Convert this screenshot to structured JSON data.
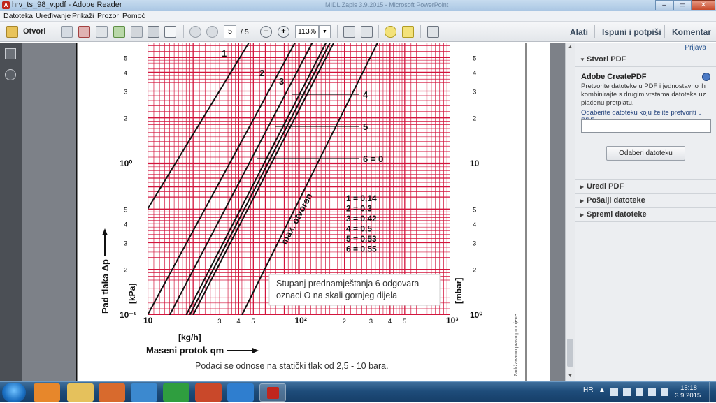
{
  "window": {
    "title": "hrv_ts_98_v.pdf - Adobe Reader",
    "background_title": "MIDL Zapis 3.9.2015 - Microsoft PowerPoint",
    "minimize": "–",
    "maximize": "▭",
    "close": "✕"
  },
  "menu": [
    "Datoteka",
    "Uređivanje",
    "Prikaži",
    "Prozor",
    "Pomoć"
  ],
  "toolbar": {
    "open_label": "Otvori",
    "page_current": "5",
    "page_total": "/ 5",
    "zoom": "113%",
    "tools": "Alati",
    "fill_sign": "Ispuni i potpiši",
    "comment": "Komentar"
  },
  "right_pane": {
    "signin": "Prijava",
    "create_pdf": "Stvori PDF",
    "service_title": "Adobe CreatePDF",
    "service_desc": "Pretvorite datoteke u PDF i jednostavno ih kombinirajte s drugim vrstama datoteka uz plaćenu pretplatu.",
    "select_prompt": "Odaberite datoteku koju želite pretvoriti u PDF:",
    "select_button": "Odaberi datoteku",
    "sections": [
      "Uredi PDF",
      "Pošalji datoteke",
      "Spremi datoteke"
    ]
  },
  "chart_data": {
    "type": "line",
    "scale": "log-log",
    "xlabel": "Maseni protok qm",
    "x_unit": "[kg/h]",
    "ylabel": "Pad tlaka Δp",
    "y_unit_left": "[kPa]",
    "y_unit_right": "[mbar]",
    "x_ticks": [
      "10",
      "3",
      "4",
      "5",
      "10²",
      "2",
      "3",
      "4",
      "5",
      "10³"
    ],
    "y_ticks_left": [
      "10⁻¹",
      "2",
      "3",
      "4",
      "5",
      "10⁰",
      "2",
      "3",
      "4",
      "5"
    ],
    "y_ticks_right": [
      "10⁰",
      "2",
      "3",
      "4",
      "5",
      "10",
      "2",
      "3",
      "4",
      "5"
    ],
    "xlim": [
      10,
      1000
    ],
    "ylim": [
      0.1,
      7
    ],
    "grid": true,
    "series": [
      {
        "name": "1",
        "x": [
          10,
          50
        ],
        "y": [
          0.5,
          7
        ]
      },
      {
        "name": "2",
        "x": [
          10,
          100
        ],
        "y": [
          0.1,
          7
        ]
      },
      {
        "name": "3",
        "x": [
          14,
          130
        ],
        "y": [
          0.1,
          7
        ]
      },
      {
        "name": "4",
        "x": [
          18,
          160
        ],
        "y": [
          0.1,
          7
        ]
      },
      {
        "name": "5",
        "x": [
          19,
          170
        ],
        "y": [
          0.1,
          7
        ]
      },
      {
        "name": "6 = 0",
        "x": [
          20,
          180
        ],
        "y": [
          0.1,
          7
        ]
      },
      {
        "name": "max. otvoren",
        "x": [
          42,
          350
        ],
        "y": [
          0.1,
          7
        ]
      }
    ],
    "curve_labels": [
      "1",
      "2",
      "3",
      "4",
      "5",
      "6 = 0",
      "max. otvoren"
    ],
    "legend": [
      "1 = 0,14",
      "2 = 0,3",
      "3 = 0,42",
      "4 = 0,5",
      "5 = 0,53",
      "6 = 0,55"
    ],
    "note": "Stupanj prednamještanja 6 odgovara oznaci O na skali gornjeg dijela",
    "footer": "Podaci se odnose na statički tlak od 2,5 - 10 bara.",
    "side_note": "Zadržavamo pravo promjene."
  },
  "taskbar": {
    "language": "HR",
    "time": "15:18",
    "date": "3.9.2015."
  }
}
